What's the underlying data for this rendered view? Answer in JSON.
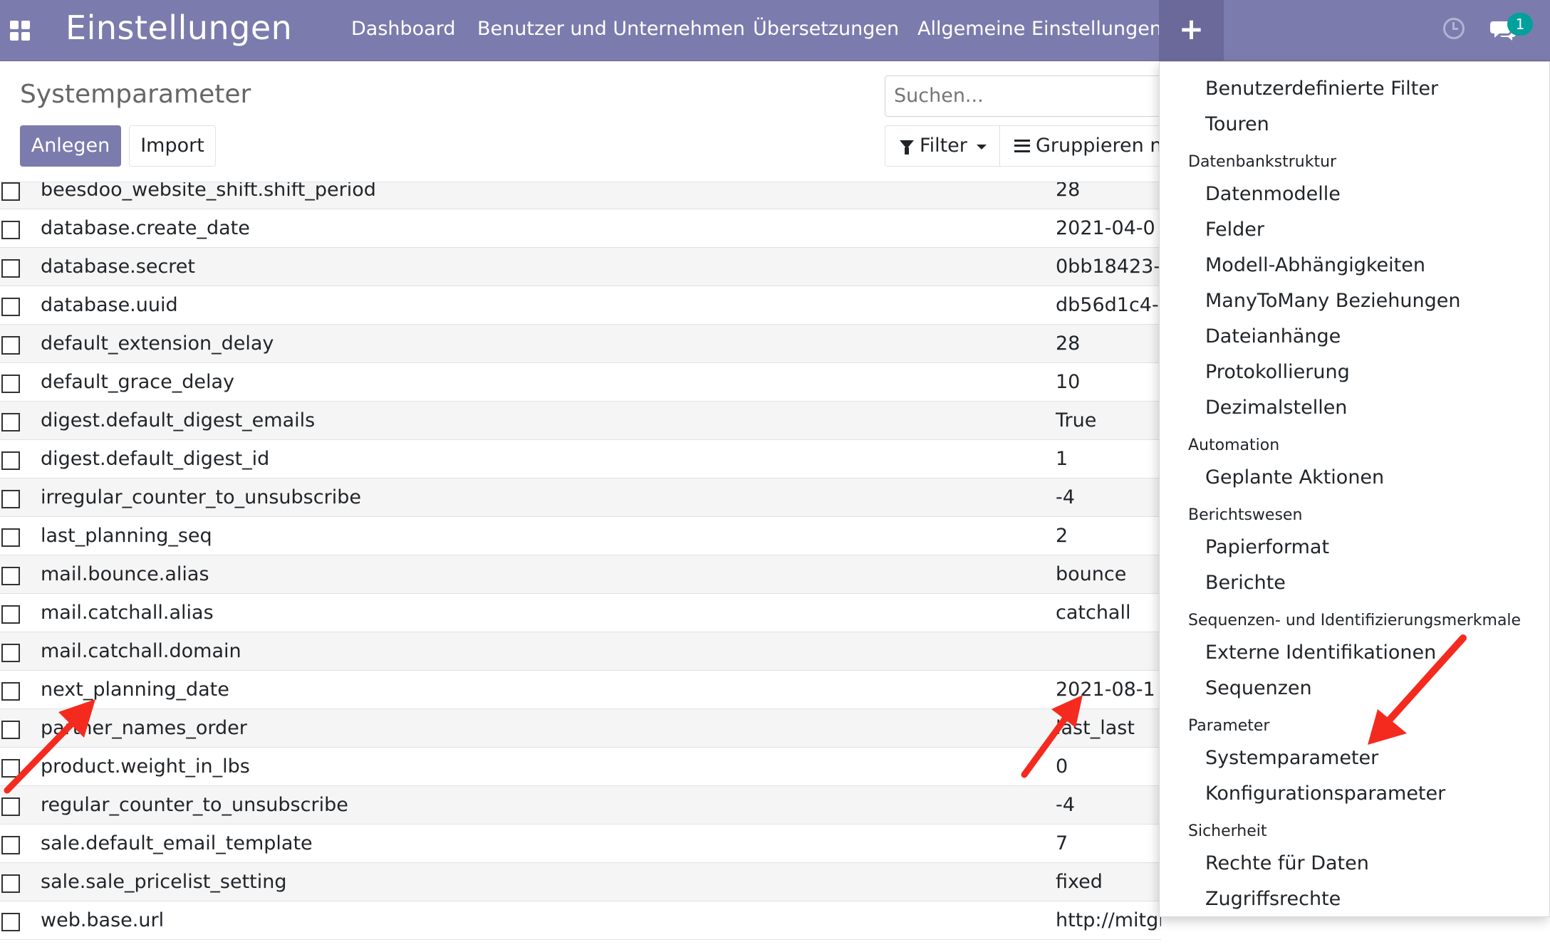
{
  "navbar": {
    "app_title": "Einstellungen",
    "menu": [
      "Dashboard",
      "Benutzer und Unternehmen",
      "Übersetzungen",
      "Allgemeine Einstellungen"
    ],
    "plus_label": "+",
    "chat_badge": "1",
    "accent_color": "#7c7bad"
  },
  "control_panel": {
    "title": "Systemparameter",
    "create_label": "Anlegen",
    "import_label": "Import",
    "search_placeholder": "Suchen...",
    "filter_label": "Filter",
    "group_label": "Gruppieren nach"
  },
  "rows": [
    {
      "key": "beesdoo_website_shift.shift_period",
      "value": "28"
    },
    {
      "key": "database.create_date",
      "value": "2021-04-0"
    },
    {
      "key": "database.secret",
      "value": "0bb18423-"
    },
    {
      "key": "database.uuid",
      "value": "db56d1c4-"
    },
    {
      "key": "default_extension_delay",
      "value": "28"
    },
    {
      "key": "default_grace_delay",
      "value": "10"
    },
    {
      "key": "digest.default_digest_emails",
      "value": "True"
    },
    {
      "key": "digest.default_digest_id",
      "value": "1"
    },
    {
      "key": "irregular_counter_to_unsubscribe",
      "value": "-4"
    },
    {
      "key": "last_planning_seq",
      "value": "2"
    },
    {
      "key": "mail.bounce.alias",
      "value": "bounce"
    },
    {
      "key": "mail.catchall.alias",
      "value": "catchall"
    },
    {
      "key": "mail.catchall.domain",
      "value": ""
    },
    {
      "key": "next_planning_date",
      "value": "2021-08-1"
    },
    {
      "key": "partner_names_order",
      "value": "last_last"
    },
    {
      "key": "product.weight_in_lbs",
      "value": "0"
    },
    {
      "key": "regular_counter_to_unsubscribe",
      "value": "-4"
    },
    {
      "key": "sale.default_email_template",
      "value": "7"
    },
    {
      "key": "sale.sale_pricelist_setting",
      "value": "fixed"
    },
    {
      "key": "web.base.url",
      "value": "http://mitglieder.foodhub-muenchen.de"
    }
  ],
  "dropdown": {
    "entries": [
      {
        "type": "item",
        "label": "Benutzerdefinierte Filter"
      },
      {
        "type": "item",
        "label": "Touren"
      },
      {
        "type": "header",
        "label": "Datenbankstruktur"
      },
      {
        "type": "item",
        "label": "Datenmodelle"
      },
      {
        "type": "item",
        "label": "Felder"
      },
      {
        "type": "item",
        "label": "Modell-Abhängigkeiten"
      },
      {
        "type": "item",
        "label": "ManyToMany Beziehungen"
      },
      {
        "type": "item",
        "label": "Dateianhänge"
      },
      {
        "type": "item",
        "label": "Protokollierung"
      },
      {
        "type": "item",
        "label": "Dezimalstellen"
      },
      {
        "type": "header",
        "label": "Automation"
      },
      {
        "type": "item",
        "label": "Geplante Aktionen"
      },
      {
        "type": "header",
        "label": "Berichtswesen"
      },
      {
        "type": "item",
        "label": "Papierformat"
      },
      {
        "type": "item",
        "label": "Berichte"
      },
      {
        "type": "header",
        "label": "Sequenzen- und Identifizierungsmerkmale"
      },
      {
        "type": "item",
        "label": "Externe Identifikationen"
      },
      {
        "type": "item",
        "label": "Sequenzen"
      },
      {
        "type": "header",
        "label": "Parameter"
      },
      {
        "type": "item",
        "label": "Systemparameter"
      },
      {
        "type": "item",
        "label": "Konfigurationsparameter"
      },
      {
        "type": "header",
        "label": "Sicherheit"
      },
      {
        "type": "item",
        "label": "Rechte für Daten"
      },
      {
        "type": "item",
        "label": "Zugriffsrechte"
      }
    ]
  },
  "annotation_color": "#f52a1f"
}
